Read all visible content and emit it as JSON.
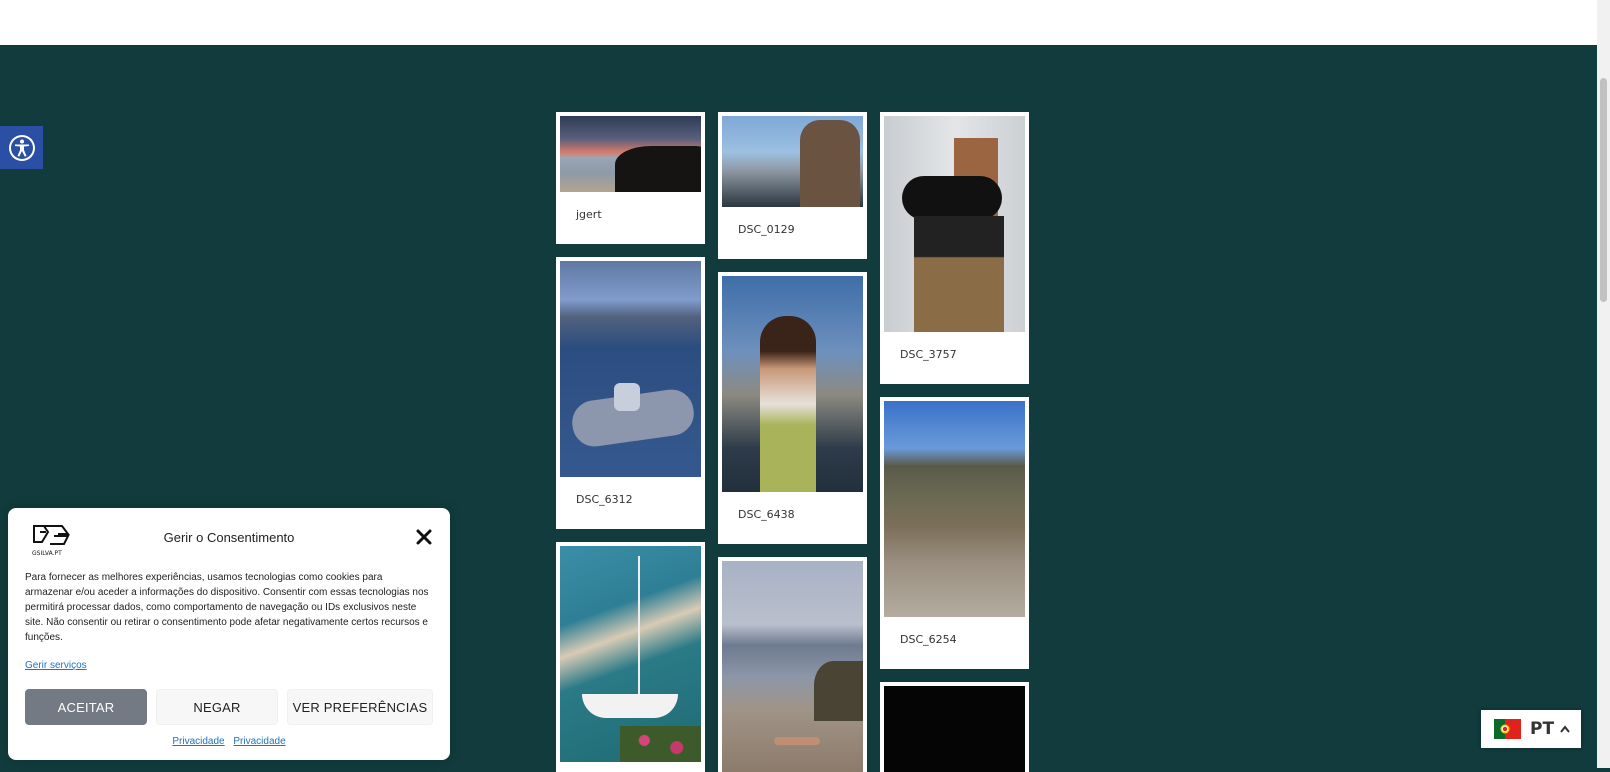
{
  "gallery": {
    "captions": [
      "jgert",
      "DSC_0129",
      "DSC_3757",
      "DSC_6312",
      "DSC_6438",
      "DSC_6254"
    ]
  },
  "consent": {
    "title": "Gerir o Consentimento",
    "body": "Para fornecer as melhores experiências, usamos tecnologias como cookies para armazenar e/ou aceder a informações do dispositivo. Consentir com essas tecnologias nos permitirá processar dados, como comportamento de navegação ou IDs exclusivos neste site. Não consentir ou retirar o consentimento pode afetar negativamente certos recursos e funções.",
    "manage_label": "Gerir serviços",
    "accept_label": "ACEITAR",
    "deny_label": "NEGAR",
    "prefs_label": "VER PREFERÊNCIAS",
    "privacy_link_1": "Privacidade",
    "privacy_link_2": "Privacidade",
    "logo_text": "GSILVA.PT"
  },
  "language": {
    "code": "PT",
    "flag_icon": "portugal-flag-icon"
  },
  "colors": {
    "page_bg": "#113b3c",
    "a11y": "#2b4fa5",
    "accept": "#737a83",
    "link": "#1e73be"
  }
}
